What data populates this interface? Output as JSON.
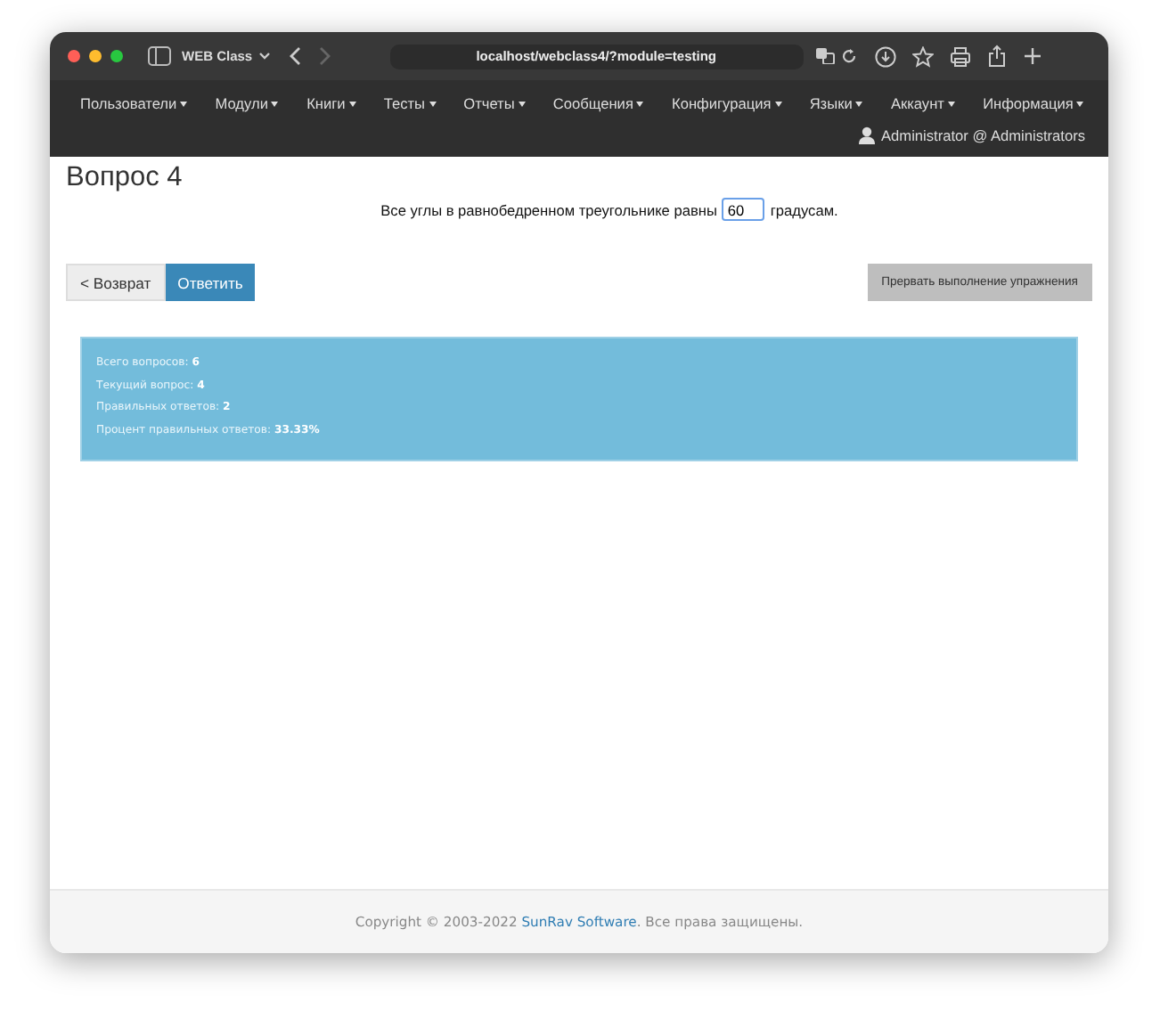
{
  "browser": {
    "tab_title": "WEB Class",
    "address": "localhost/webclass4/?module=testing"
  },
  "menu": [
    "Пользователи",
    "Модули",
    "Книги",
    "Тесты",
    "Отчеты",
    "Сообщения",
    "Конфигурация",
    "Языки",
    "Аккаунт",
    "Информация"
  ],
  "user": "Administrator @ Administrators",
  "heading": "Вопрос 4",
  "question": {
    "before": "Все углы в равнобедренном треугольнике равны",
    "value": "60",
    "after": "градусам."
  },
  "buttons": {
    "back": "< Возврат",
    "answer": "Ответить",
    "abort": "Прервать выполнение упражнения"
  },
  "stats": [
    "Всего вопросов: **6**",
    "Текущий вопрос: **4**",
    "Правильных ответов: **2**",
    "Процент правильных ответов: **33.33%**"
  ],
  "footer": {
    "before": "Copyright © 2003-2022",
    "link": "SunRav Software",
    "after": ". Все права защищены."
  }
}
